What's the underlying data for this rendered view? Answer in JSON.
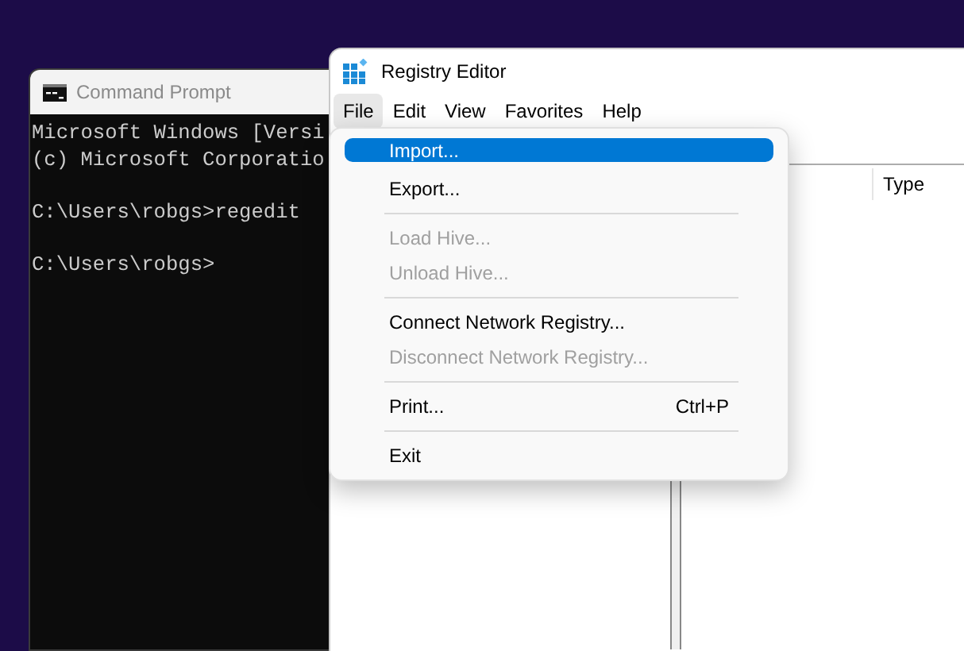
{
  "console_window": {
    "title": "Command Prompt",
    "blocks": [
      [
        "Microsoft Windows [Versi",
        "(c) Microsoft Corporatio"
      ],
      [
        "C:\\Users\\robgs>regedit"
      ],
      [
        "C:\\Users\\robgs>"
      ]
    ]
  },
  "registry_window": {
    "title": "Registry Editor",
    "menu": [
      {
        "label": "File",
        "selected": true
      },
      {
        "label": "Edit",
        "selected": false
      },
      {
        "label": "View",
        "selected": false
      },
      {
        "label": "Favorites",
        "selected": false
      },
      {
        "label": "Help",
        "selected": false
      }
    ],
    "columns": [
      "Type"
    ],
    "file_menu": [
      {
        "kind": "item",
        "label": "Import...",
        "selected": true,
        "disabled": false
      },
      {
        "kind": "item",
        "label": "Export...",
        "selected": false,
        "disabled": false
      },
      {
        "kind": "separator"
      },
      {
        "kind": "item",
        "label": "Load Hive...",
        "selected": false,
        "disabled": true
      },
      {
        "kind": "item",
        "label": "Unload Hive...",
        "selected": false,
        "disabled": true
      },
      {
        "kind": "separator"
      },
      {
        "kind": "item",
        "label": "Connect Network Registry...",
        "selected": false,
        "disabled": false
      },
      {
        "kind": "item",
        "label": "Disconnect Network Registry...",
        "selected": false,
        "disabled": true
      },
      {
        "kind": "separator"
      },
      {
        "kind": "item",
        "label": "Print...",
        "shortcut": "Ctrl+P",
        "selected": false,
        "disabled": false
      },
      {
        "kind": "separator"
      },
      {
        "kind": "item",
        "label": "Exit",
        "selected": false,
        "disabled": false
      }
    ]
  }
}
